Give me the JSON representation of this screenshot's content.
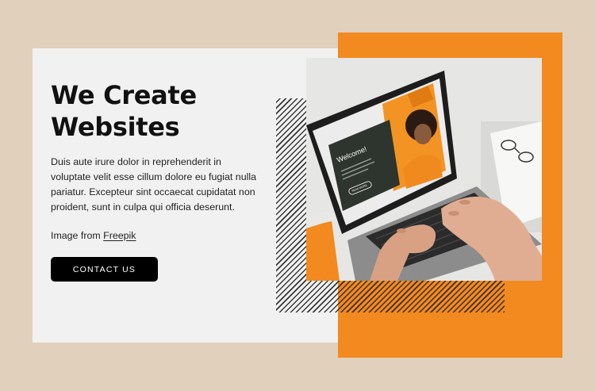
{
  "hero": {
    "title_line1": "We Create",
    "title_line2": "Websites",
    "body": "Duis aute irure dolor in reprehenderit in voluptate velit esse cillum dolore eu fugiat nulla pariatur. Excepteur sint occaecat cupidatat non proident, sunt in culpa qui officia deserunt.",
    "credit_prefix": "Image from",
    "credit_link": "Freepik",
    "cta_label": "CONTACT US"
  },
  "photo": {
    "screen_heading": "Welcome!",
    "screen_button": "READ MORE"
  },
  "colors": {
    "background": "#e0d0bc",
    "card": "#f1f1f1",
    "accent": "#f28a1f",
    "cta": "#000000"
  }
}
